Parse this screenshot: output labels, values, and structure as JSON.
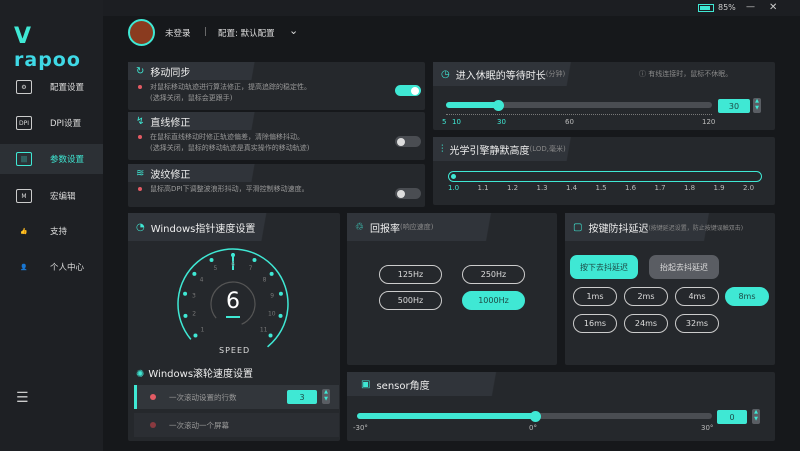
{
  "app": {
    "brand": "rapoo",
    "battery": "85%",
    "minimize": "—",
    "close": "✕"
  },
  "header": {
    "user": "未登录",
    "separator": "|",
    "profile": "配置: 默认配置"
  },
  "sidebar": {
    "items": [
      {
        "label": "配置设置",
        "icon": "⚙"
      },
      {
        "label": "DPI设置",
        "icon": "DPI"
      },
      {
        "label": "参数设置",
        "icon": "|||"
      },
      {
        "label": "宏编辑",
        "icon": "M"
      },
      {
        "label": "支持",
        "icon": "👍"
      },
      {
        "label": "个人中心",
        "icon": "👤"
      }
    ],
    "active": 2
  },
  "features": [
    {
      "title": "移动同步",
      "icon": "↻",
      "lines": [
        "对鼠标移动轨迹进行算法修正，提高追踪的稳定性。",
        "(选择关闭，鼠标会更跟手)"
      ],
      "on": true
    },
    {
      "title": "直线修正",
      "icon": "↯",
      "lines": [
        "在鼠标直线移动时修正轨迹偏差，清除偏移抖动。",
        "(选择关闭，鼠标的移动轨迹是真实操作的移动轨迹)"
      ],
      "on": false
    },
    {
      "title": "波纹修正",
      "icon": "≋",
      "lines": [
        "鼠标高DPI下调整波浪形抖动，平滑控制移动速度。"
      ],
      "on": false
    }
  ],
  "sleep": {
    "title": "进入休眠的等待时长",
    "unit": "(分钟)",
    "note": "ⓘ 有线连接时，鼠标不休眠。",
    "value": "30",
    "min": 5,
    "max": 120,
    "current": 30,
    "ticks": [
      "5",
      "10",
      "30",
      "60",
      "120"
    ]
  },
  "lod": {
    "title": "光学引擎静默高度",
    "unit": "(LOD,毫米)",
    "ticks": [
      "1.0",
      "1.1",
      "1.2",
      "1.3",
      "1.4",
      "1.5",
      "1.6",
      "1.7",
      "1.8",
      "1.9",
      "2.0"
    ],
    "current": 1.0
  },
  "pointer": {
    "title": "Windows指针速度设置",
    "value": "6",
    "label": "SPEED",
    "dial": [
      "1",
      "2",
      "3",
      "4",
      "5",
      "6",
      "7",
      "8",
      "9",
      "10",
      "11"
    ]
  },
  "scroll": {
    "title": "Windows滚轮速度设置",
    "rows": [
      {
        "label": "一次滚动设置的行数",
        "value": "3"
      },
      {
        "label": "一次滚动一个屏幕"
      }
    ]
  },
  "report": {
    "title": "回报率",
    "unit": "(响应速度)",
    "options": [
      "125Hz",
      "250Hz",
      "500Hz",
      "1000Hz"
    ],
    "selected": "1000Hz"
  },
  "debounce": {
    "title": "按键防抖延迟",
    "unit": "(按键延迟设置，防止按键误触双击)",
    "modes": [
      "按下去抖延迟",
      "抬起去抖延迟"
    ],
    "options": [
      "1ms",
      "2ms",
      "4ms",
      "8ms",
      "16ms",
      "24ms",
      "32ms"
    ],
    "selected": "8ms"
  },
  "sensor": {
    "title": "sensor角度",
    "value": "0",
    "min": -30,
    "max": 30,
    "current": 0,
    "ticks": [
      "-30°",
      "0°",
      "30°"
    ]
  },
  "colors": {
    "accent": "#3fe8d4",
    "dot": "#e35b64"
  }
}
